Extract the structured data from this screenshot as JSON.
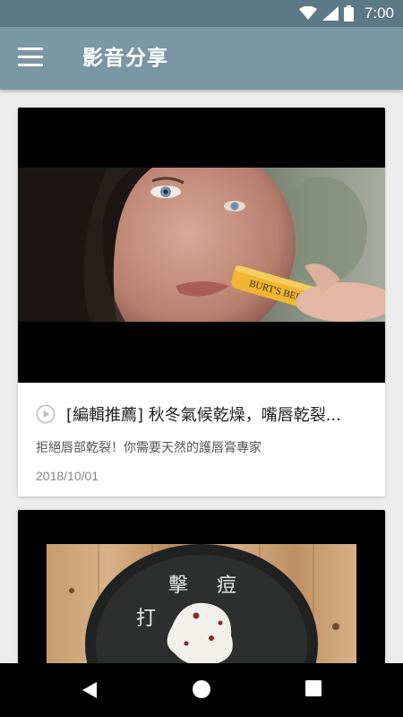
{
  "status_bar": {
    "time": "7:00",
    "icons": [
      "wifi-icon",
      "signal-icon",
      "battery-icon"
    ]
  },
  "app_bar": {
    "title": "影音分享",
    "menu_icon": "hamburger-menu-icon"
  },
  "cards": [
    {
      "title": "[編輯推薦] 秋冬氣候乾燥，嘴唇乾裂...",
      "description": "拒絕唇部乾裂！你需要天然的護唇膏專家",
      "date": "2018/10/01",
      "thumbnail_text": "BURT'S BEES",
      "icon": "play-circle-icon"
    },
    {
      "thumbnail_text_1": "擊",
      "thumbnail_text_2": "痘",
      "thumbnail_text_3": "打"
    }
  ],
  "nav_bar": {
    "icons": [
      "back-icon",
      "home-icon",
      "recents-icon"
    ]
  },
  "colors": {
    "status_bar": "#5d7887",
    "app_bar": "#7a97a6",
    "background": "#ececec"
  }
}
